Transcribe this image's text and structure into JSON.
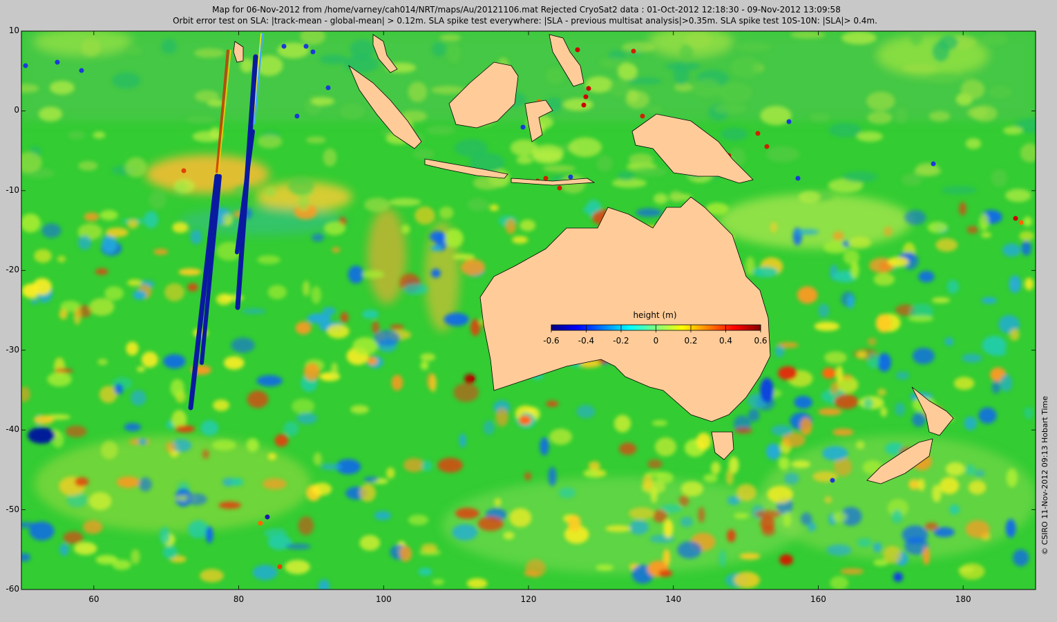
{
  "title_line1": "Map for 06-Nov-2012 from /home/varney/cah014/NRT/maps/Au/20121106.mat  Rejected CryoSat2 data : 01-Oct-2012 12:18:30 - 09-Nov-2012 13:09:58",
  "title_line2": "Orbit error test on SLA: |track-mean  - global-mean| > 0.12m.  SLA spike test everywhere: |SLA - previous multisat analysis|>0.35m. SLA spike test 10S-10N: |SLA|> 0.4m.",
  "credit": "© CSIRO 11-Nov-2012 09:13 Hobart Time",
  "colorbar": {
    "label": "height (m)",
    "min": -0.6,
    "max": 0.6,
    "ticks": [
      "-0.6",
      "-0.4",
      "-0.2",
      "0",
      "0.2",
      "0.4",
      "0.6"
    ],
    "colors": [
      "#000080",
      "#0000ff",
      "#0080ff",
      "#00ffff",
      "#80ff80",
      "#ffff00",
      "#ff8000",
      "#ff0000",
      "#800000"
    ]
  },
  "colors": {
    "land": "#ffcc99",
    "ocean_base": "#33cc33",
    "page_background": "#c8c8c8"
  },
  "map": {
    "lon_range": [
      50,
      190
    ],
    "lat_range": [
      -60,
      10
    ],
    "lon_ticks": [
      "60",
      "80",
      "100",
      "120",
      "140",
      "160",
      "180"
    ],
    "lat_ticks": [
      "10",
      "0",
      "-10",
      "-20",
      "-30",
      "-40",
      "-50",
      "-60"
    ]
  }
}
